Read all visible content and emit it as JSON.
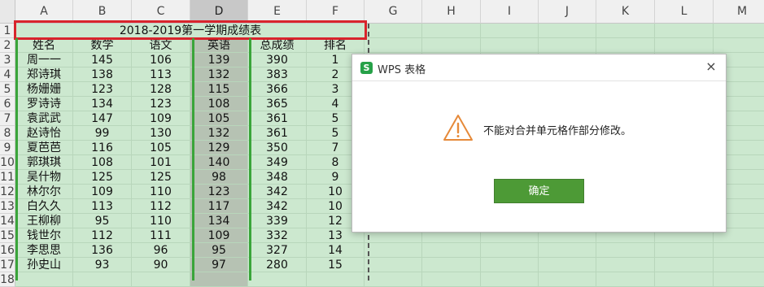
{
  "sheet": {
    "columns": [
      "A",
      "B",
      "C",
      "D",
      "E",
      "F",
      "G",
      "H",
      "I",
      "J",
      "K",
      "L",
      "M"
    ],
    "selected_column": "D",
    "rows": [
      "1",
      "2",
      "3",
      "4",
      "5",
      "6",
      "7",
      "8",
      "9",
      "10",
      "11",
      "12",
      "13",
      "14",
      "15",
      "16",
      "17",
      "18"
    ],
    "title": "2018-2019第一学期成绩表",
    "headers": [
      "姓名",
      "数学",
      "语文",
      "英语",
      "总成绩",
      "排名"
    ],
    "data": [
      [
        "周一一",
        "145",
        "106",
        "139",
        "390",
        "1"
      ],
      [
        "郑诗琪",
        "138",
        "113",
        "132",
        "383",
        "2"
      ],
      [
        "杨姗姗",
        "123",
        "128",
        "115",
        "366",
        "3"
      ],
      [
        "罗诗诗",
        "134",
        "123",
        "108",
        "365",
        "4"
      ],
      [
        "袁武武",
        "147",
        "109",
        "105",
        "361",
        "5"
      ],
      [
        "赵诗怡",
        "99",
        "130",
        "132",
        "361",
        "5"
      ],
      [
        "夏芭芭",
        "116",
        "105",
        "129",
        "350",
        "7"
      ],
      [
        "郭琪琪",
        "108",
        "101",
        "140",
        "349",
        "8"
      ],
      [
        "吴什物",
        "125",
        "125",
        "98",
        "348",
        "9"
      ],
      [
        "林尔尔",
        "109",
        "110",
        "123",
        "342",
        "10"
      ],
      [
        "白久久",
        "113",
        "112",
        "117",
        "342",
        "10"
      ],
      [
        "王柳柳",
        "95",
        "110",
        "134",
        "339",
        "12"
      ],
      [
        "钱世尔",
        "112",
        "111",
        "109",
        "332",
        "13"
      ],
      [
        "李思思",
        "136",
        "96",
        "95",
        "327",
        "14"
      ],
      [
        "孙史山",
        "93",
        "90",
        "97",
        "280",
        "15"
      ]
    ]
  },
  "dialog": {
    "app_icon_letter": "S",
    "title": "WPS 表格",
    "close_glyph": "×",
    "message": "不能对合并单元格作部分修改。",
    "ok_label": "确定",
    "warning_icon": "warning-triangle-icon",
    "accent": "#4d9a36"
  },
  "colors": {
    "sheet_bg": "#cce8cf",
    "selected_column_bg": "#b6c2b3",
    "error_outline": "#d8242c",
    "selection_outline": "#3aa53a"
  }
}
